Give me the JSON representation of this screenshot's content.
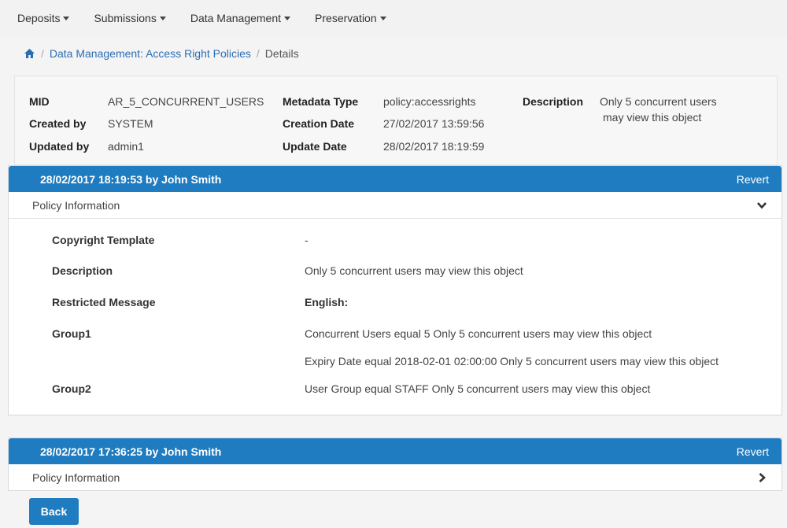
{
  "nav": {
    "items": [
      {
        "label": "Deposits"
      },
      {
        "label": "Submissions"
      },
      {
        "label": "Data Management"
      },
      {
        "label": "Preservation"
      }
    ]
  },
  "breadcrumb": {
    "parent": "Data Management: Access Right Policies",
    "current": "Details"
  },
  "details": {
    "mid_label": "MID",
    "mid_value": "AR_5_CONCURRENT_USERS",
    "created_by_label": "Created by",
    "created_by_value": "SYSTEM",
    "updated_by_label": "Updated by",
    "updated_by_value": "admin1",
    "metadata_type_label": "Metadata Type",
    "metadata_type_value": "policy:accessrights",
    "creation_date_label": "Creation Date",
    "creation_date_value": "27/02/2017 13:59:56",
    "update_date_label": "Update Date",
    "update_date_value": "28/02/2017 18:19:59",
    "description_label": "Description",
    "description_line1": "Only 5 concurrent users",
    "description_line2": "may view this object"
  },
  "versions": [
    {
      "header": "28/02/2017 18:19:53 by John Smith",
      "revert": "Revert",
      "section": "Policy Information",
      "expanded": true,
      "rows": [
        {
          "key": "Copyright Template",
          "value": "-"
        },
        {
          "key": "Description",
          "value": "Only 5 concurrent users may view this object"
        },
        {
          "key": "Restricted Message",
          "value": "English:"
        },
        {
          "key": "Group1",
          "value": "Concurrent Users equal 5 Only 5 concurrent users may view this object"
        },
        {
          "key": "",
          "value": "Expiry Date equal 2018-02-01 02:00:00 Only 5 concurrent users may view this object"
        },
        {
          "key": "Group2",
          "value": "User Group equal STAFF Only 5 concurrent users may view this object"
        }
      ]
    },
    {
      "header": "28/02/2017 17:36:25 by John Smith",
      "revert": "Revert",
      "section": "Policy Information",
      "expanded": false
    }
  ],
  "back_label": "Back",
  "colors": {
    "accent": "#1f7cc0",
    "link": "#2a6eb4"
  }
}
